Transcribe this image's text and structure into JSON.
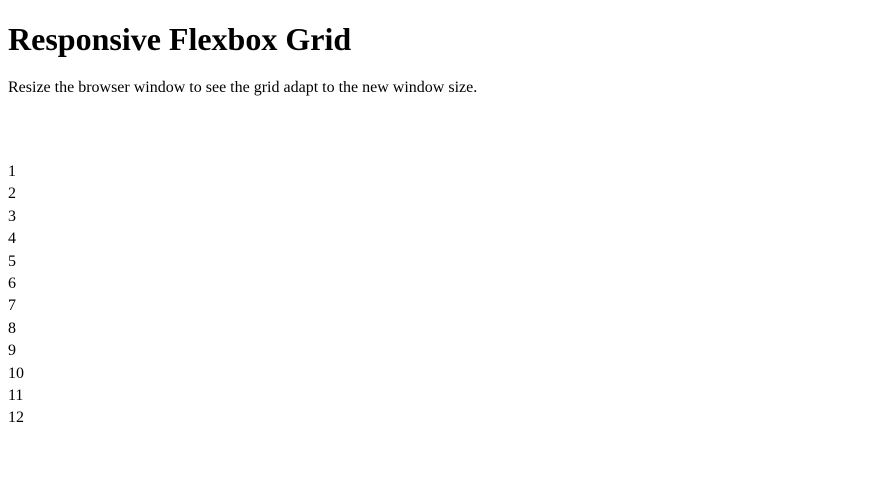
{
  "heading": "Responsive Flexbox Grid",
  "description": "Resize the browser window to see the grid adapt to the new window size.",
  "items": [
    "1",
    "2",
    "3",
    "4",
    "5",
    "6",
    "7",
    "8",
    "9",
    "10",
    "11",
    "12"
  ]
}
